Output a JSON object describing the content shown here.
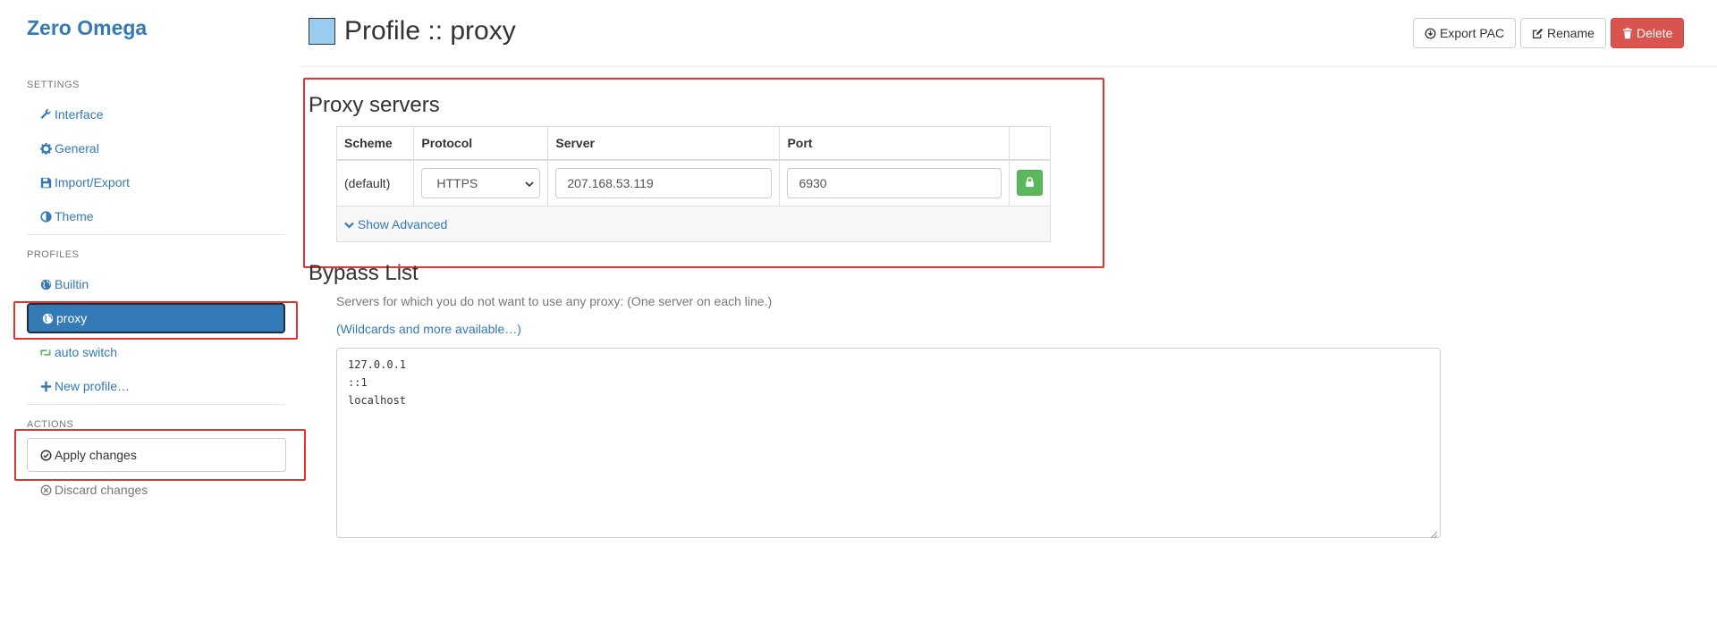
{
  "app": {
    "brand": "Zero Omega"
  },
  "sidebar": {
    "settings_header": "SETTINGS",
    "settings_items": [
      {
        "label": "Interface",
        "icon": "wrench-icon"
      },
      {
        "label": "General",
        "icon": "gear-icon"
      },
      {
        "label": "Import/Export",
        "icon": "floppy-icon"
      },
      {
        "label": "Theme",
        "icon": "contrast-icon"
      }
    ],
    "profiles_header": "PROFILES",
    "profile_items": [
      {
        "label": "Builtin",
        "icon": "globe-icon"
      },
      {
        "label": "proxy",
        "icon": "globe-icon",
        "active": true
      },
      {
        "label": "auto switch",
        "icon": "retweet-icon"
      },
      {
        "label": "New profile…",
        "icon": "plus-icon"
      }
    ],
    "actions_header": "ACTIONS",
    "apply_label": "Apply changes",
    "discard_label": "Discard changes"
  },
  "header": {
    "title": "Profile :: proxy",
    "swatch_color": "#99ccee",
    "export_label": "Export PAC",
    "rename_label": "Rename",
    "delete_label": "Delete"
  },
  "proxy_servers": {
    "title": "Proxy servers",
    "columns": [
      "Scheme",
      "Protocol",
      "Server",
      "Port"
    ],
    "row": {
      "scheme": "(default)",
      "protocol": "HTTPS",
      "server": "207.168.53.119",
      "port": "6930"
    },
    "show_advanced": "Show Advanced"
  },
  "bypass": {
    "title": "Bypass List",
    "help": "Servers for which you do not want to use any proxy: (One server on each line.)",
    "wildcards_link": "(Wildcards and more available…)",
    "text": "127.0.0.1\n::1\nlocalhost"
  },
  "colors": {
    "accent": "#337ab7",
    "danger": "#d9534f",
    "success": "#5cb85c",
    "annotation": "#e0342c"
  }
}
